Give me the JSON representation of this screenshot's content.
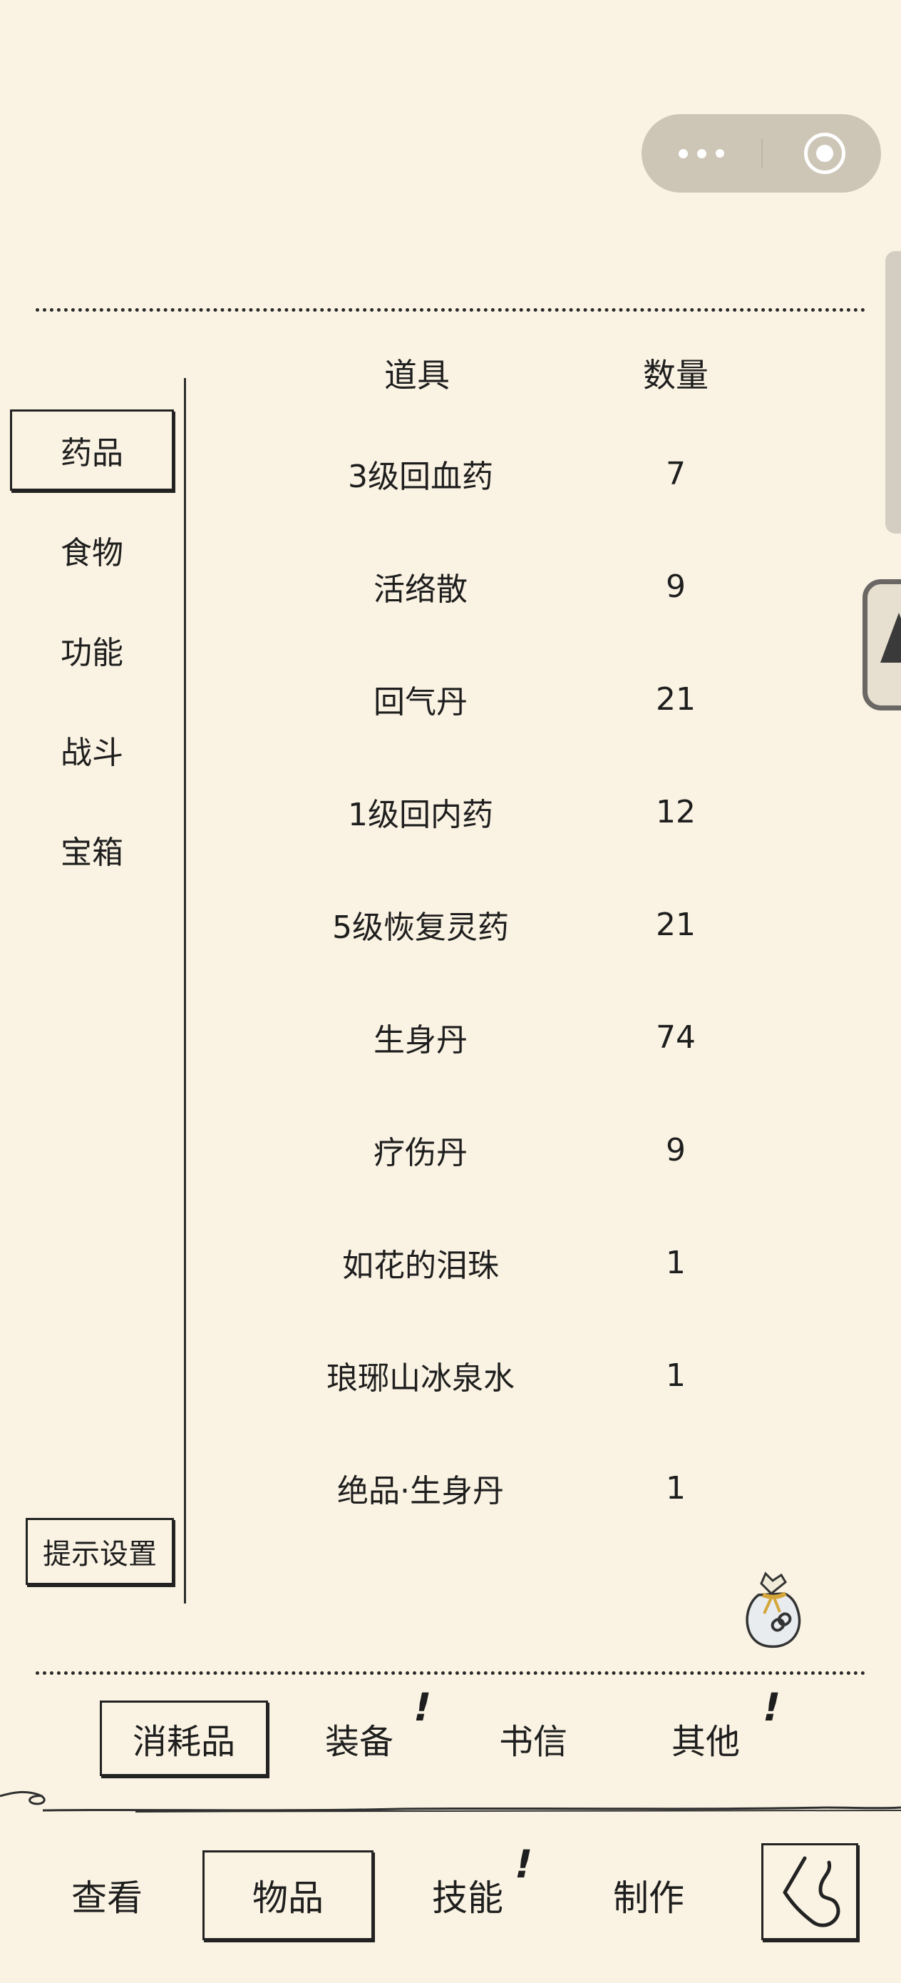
{
  "capsule": {
    "more_icon": "more-dots-icon",
    "close_icon": "target-close-icon"
  },
  "categories": [
    "药品",
    "食物",
    "功能",
    "战斗",
    "宝箱"
  ],
  "active_category": "药品",
  "hint_button": "提示设置",
  "table": {
    "headers": [
      "道具",
      "数量"
    ],
    "rows": [
      {
        "name": "3级回血药",
        "qty": "7"
      },
      {
        "name": "活络散",
        "qty": "9"
      },
      {
        "name": "回气丹",
        "qty": "21"
      },
      {
        "name": "1级回内药",
        "qty": "12"
      },
      {
        "name": "5级恢复灵药",
        "qty": "21"
      },
      {
        "name": "生身丹",
        "qty": "74"
      },
      {
        "name": "疗伤丹",
        "qty": "9"
      },
      {
        "name": "如花的泪珠",
        "qty": "1"
      },
      {
        "name": "琅琊山冰泉水",
        "qty": "1"
      },
      {
        "name": "绝品·生身丹",
        "qty": "1"
      }
    ]
  },
  "sub_tabs": [
    "消耗品",
    "装备",
    "书信",
    "其他"
  ],
  "active_sub_tab": "消耗品",
  "notify_mark": "!",
  "nav_tabs": [
    "查看",
    "物品",
    "技能",
    "制作"
  ],
  "active_nav_tab": "物品",
  "icons": {
    "bag": "item-bag-icon",
    "back": "back-arrow-icon"
  }
}
